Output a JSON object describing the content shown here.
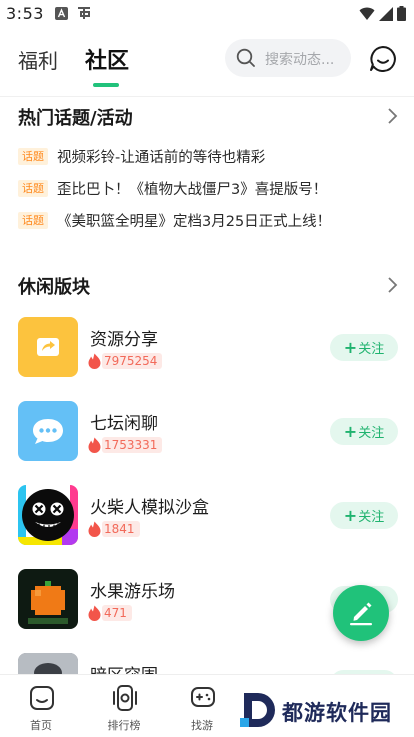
{
  "status_bar": {
    "time": "3:53"
  },
  "header": {
    "tabs": [
      {
        "label": "福利"
      },
      {
        "label": "社区"
      }
    ],
    "search_placeholder": "搜索动态..."
  },
  "hot_topics": {
    "title": "热门话题/活动",
    "tag_label": "话题",
    "items": [
      {
        "text": "视频彩铃-让通话前的等待也精彩"
      },
      {
        "text": "歪比巴卜！《植物大战僵尸3》喜提版号！"
      },
      {
        "text": "《美职篮全明星》定档3月25日正式上线！"
      }
    ]
  },
  "leisure": {
    "title": "休闲版块",
    "follow_label": "关注",
    "boards": [
      {
        "name": "资源分享",
        "heat": "7975254"
      },
      {
        "name": "七坛闲聊",
        "heat": "1753331"
      },
      {
        "name": "火柴人模拟沙盒",
        "heat": "1841"
      },
      {
        "name": "水果游乐场",
        "heat": "471"
      },
      {
        "name": "暗区突围",
        "heat": ""
      }
    ]
  },
  "bottom_nav": {
    "items": [
      {
        "label": "首页"
      },
      {
        "label": "排行榜"
      },
      {
        "label": "找游"
      }
    ]
  },
  "watermark": {
    "text": "都游软件园"
  },
  "colors": {
    "accent": "#21c27b",
    "tag": "#ff8a1f",
    "heat": "#f26a5a"
  }
}
